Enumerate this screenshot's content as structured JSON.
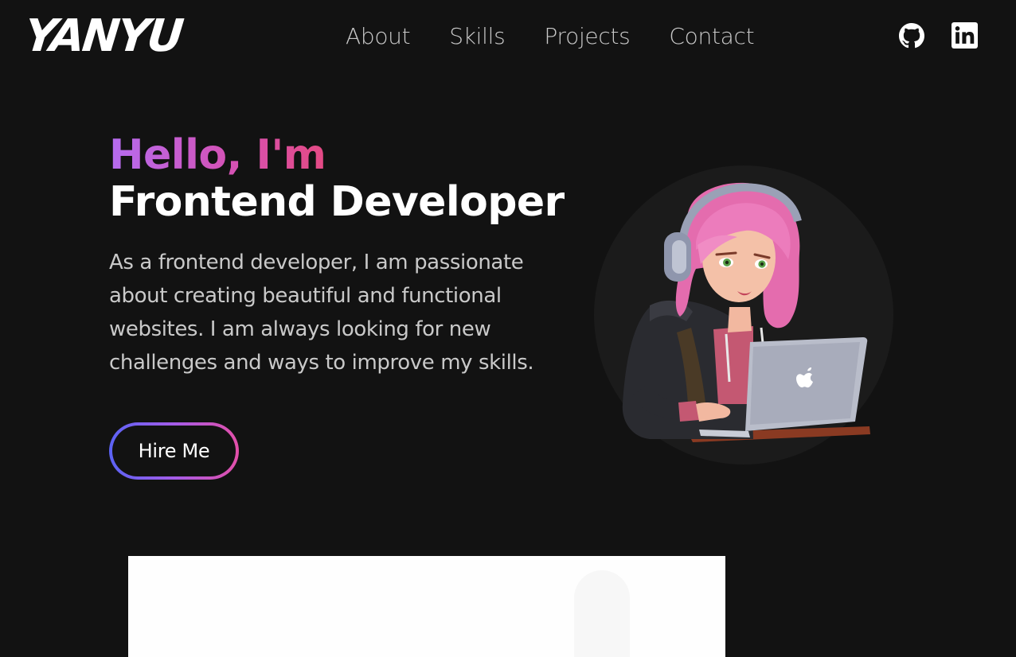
{
  "header": {
    "logo": "YANYU",
    "nav": [
      "About",
      "Skills",
      "Projects",
      "Contact"
    ],
    "social_icons": [
      "github-icon",
      "linkedin-icon"
    ]
  },
  "hero": {
    "greeting": "Hello, I'm",
    "role": "Frontend Developer",
    "description": "As a frontend developer, I am passionate about creating beautiful and functional websites. I am always looking for new challenges and ways to improve my skills.",
    "cta_label": "Hire Me",
    "avatar": "avatar-illustration"
  },
  "colors": {
    "background": "#121212",
    "gradient_start": "#5b63f5",
    "gradient_mid": "#b56cf0",
    "gradient_end": "#e34fa9",
    "text_primary": "#ffffff",
    "text_secondary": "#c9c9c9"
  }
}
